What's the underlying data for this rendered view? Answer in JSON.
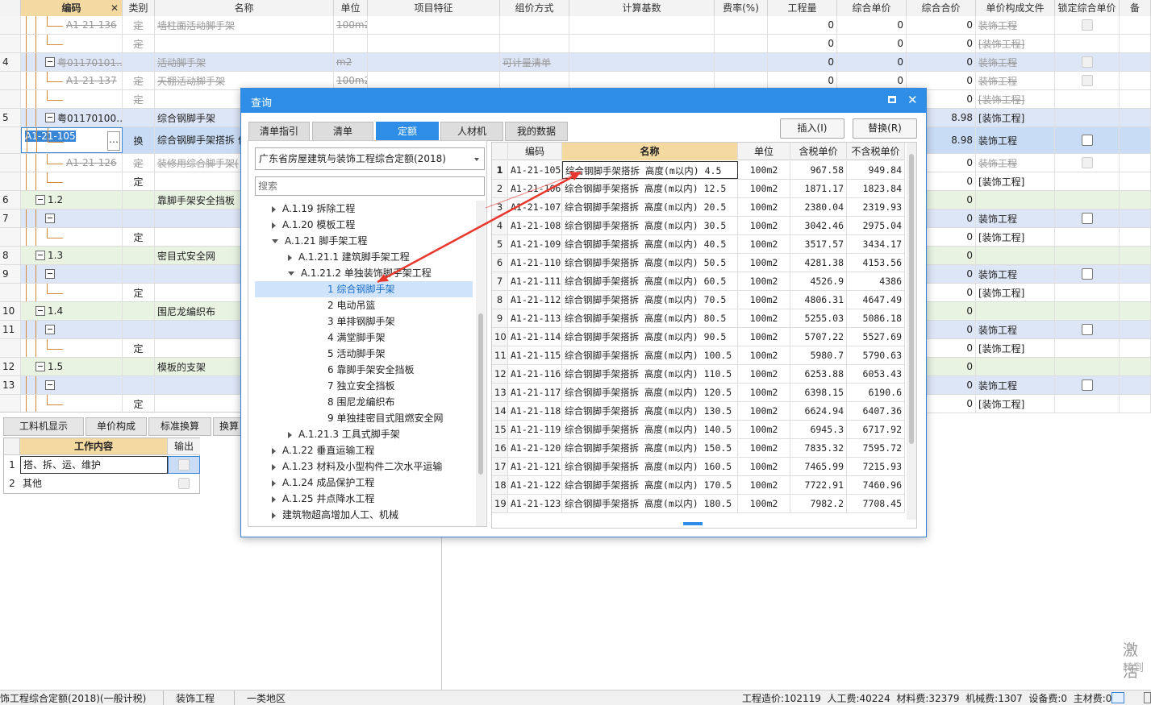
{
  "header": {
    "cols": [
      "编码",
      "类别",
      "名称",
      "单位",
      "项目特征",
      "组价方式",
      "计算基数",
      "费率(%)",
      "工程量",
      "综合单价",
      "综合合价",
      "单价构成文件",
      "锁定综合单价"
    ]
  },
  "rows": [
    {
      "no": "",
      "code": "A1-21-136",
      "type": "定",
      "name": "墙柱面活动脚手架",
      "unit": "100m2",
      "feat": "",
      "method": "",
      "base": "",
      "rate": "",
      "qty": "0",
      "price": "0",
      "total": "0",
      "file": "装饰工程",
      "strike": true,
      "bg": "#ffffff",
      "lvl": 2
    },
    {
      "no": "",
      "code": "",
      "type": "定",
      "name": "",
      "unit": "",
      "feat": "",
      "method": "",
      "base": "",
      "rate": "",
      "qty": "0",
      "price": "0",
      "total": "0",
      "file": "[装饰工程]",
      "strike": true,
      "bg": "#ffffff",
      "lvl": 2
    },
    {
      "no": "4",
      "code": "粤01170101…",
      "type": "",
      "name": "活动脚手架",
      "unit": "m2",
      "feat": "",
      "method": "可计量清单",
      "base": "",
      "rate": "",
      "qty": "0",
      "price": "0",
      "total": "0",
      "file": "装饰工程",
      "strike": true,
      "bg": "#dde6f7",
      "lvl": 1,
      "minus": true
    },
    {
      "no": "",
      "code": "A1-21-137",
      "type": "定",
      "name": "天棚活动脚手架",
      "unit": "100m2",
      "feat": "",
      "method": "",
      "base": "",
      "rate": "",
      "qty": "0",
      "price": "0",
      "total": "0",
      "file": "装饰工程",
      "strike": true,
      "bg": "#ffffff",
      "lvl": 2
    },
    {
      "no": "",
      "code": "",
      "type": "定",
      "name": "",
      "unit": "",
      "feat": "",
      "method": "",
      "base": "",
      "rate": "",
      "qty": "0",
      "price": "0",
      "total": "0",
      "file": "[装饰工程]",
      "strike": true,
      "bg": "#ffffff",
      "lvl": 2
    },
    {
      "no": "5",
      "code": "粤01170100…",
      "type": "",
      "name": "综合钢脚手架",
      "unit": "",
      "feat": "",
      "method": "",
      "base": "",
      "rate": "",
      "qty": "",
      "price": "",
      "total": "8.98",
      "file": "[装饰工程]",
      "strike": false,
      "bg": "#dde6f7",
      "lvl": 1,
      "minus": true
    },
    {
      "no": "",
      "code": "A1-21-105",
      "type": "换",
      "name": "综合钢脚手架搭拆 价*0.8",
      "unit": "",
      "feat": "",
      "method": "",
      "base": "",
      "rate": "",
      "qty": "",
      "price": "",
      "total": "8.98",
      "file": "装饰工程",
      "strike": false,
      "bg": "#c9dcf5",
      "lvl": 2
    },
    {
      "no": "",
      "code": "A1-21-126",
      "type": "定",
      "name": "装修用综合脚手架(",
      "unit": "",
      "feat": "",
      "method": "",
      "base": "",
      "rate": "",
      "qty": "",
      "price": "",
      "total": "0",
      "file": "装饰工程",
      "strike": true,
      "bg": "#ffffff",
      "lvl": 2
    },
    {
      "no": "",
      "code": "",
      "type": "定",
      "name": "",
      "unit": "",
      "feat": "",
      "method": "",
      "base": "",
      "rate": "",
      "qty": "",
      "price": "",
      "total": "0",
      "file": "[装饰工程]",
      "strike": false,
      "bg": "#ffffff",
      "lvl": 2
    },
    {
      "no": "6",
      "code": "1.2",
      "type": "",
      "name": "靠脚手架安全挡板",
      "unit": "",
      "feat": "",
      "method": "",
      "base": "",
      "rate": "",
      "qty": "",
      "price": "",
      "total": "0",
      "file": "",
      "strike": false,
      "bg": "#e8f3e2",
      "lvl": 0,
      "minus": true
    },
    {
      "no": "7",
      "code": "",
      "type": "",
      "name": "",
      "unit": "",
      "feat": "",
      "method": "",
      "base": "",
      "rate": "",
      "qty": "",
      "price": "",
      "total": "0",
      "file": "装饰工程",
      "strike": false,
      "bg": "#dde6f7",
      "lvl": 1,
      "minus": true
    },
    {
      "no": "",
      "code": "",
      "type": "定",
      "name": "",
      "unit": "",
      "feat": "",
      "method": "",
      "base": "",
      "rate": "",
      "qty": "",
      "price": "",
      "total": "0",
      "file": "[装饰工程]",
      "strike": false,
      "bg": "#ffffff",
      "lvl": 2
    },
    {
      "no": "8",
      "code": "1.3",
      "type": "",
      "name": "密目式安全网",
      "unit": "",
      "feat": "",
      "method": "",
      "base": "",
      "rate": "",
      "qty": "",
      "price": "",
      "total": "0",
      "file": "",
      "strike": false,
      "bg": "#e8f3e2",
      "lvl": 0,
      "minus": true
    },
    {
      "no": "9",
      "code": "",
      "type": "",
      "name": "",
      "unit": "",
      "feat": "",
      "method": "",
      "base": "",
      "rate": "",
      "qty": "",
      "price": "",
      "total": "0",
      "file": "装饰工程",
      "strike": false,
      "bg": "#dde6f7",
      "lvl": 1,
      "minus": true
    },
    {
      "no": "",
      "code": "",
      "type": "定",
      "name": "",
      "unit": "",
      "feat": "",
      "method": "",
      "base": "",
      "rate": "",
      "qty": "",
      "price": "",
      "total": "0",
      "file": "[装饰工程]",
      "strike": false,
      "bg": "#ffffff",
      "lvl": 2
    },
    {
      "no": "10",
      "code": "1.4",
      "type": "",
      "name": "围尼龙编织布",
      "unit": "",
      "feat": "",
      "method": "",
      "base": "",
      "rate": "",
      "qty": "",
      "price": "",
      "total": "0",
      "file": "",
      "strike": false,
      "bg": "#e8f3e2",
      "lvl": 0,
      "minus": true
    },
    {
      "no": "11",
      "code": "",
      "type": "",
      "name": "",
      "unit": "",
      "feat": "",
      "method": "",
      "base": "",
      "rate": "",
      "qty": "",
      "price": "",
      "total": "0",
      "file": "装饰工程",
      "strike": false,
      "bg": "#dde6f7",
      "lvl": 1,
      "minus": true
    },
    {
      "no": "",
      "code": "",
      "type": "定",
      "name": "",
      "unit": "",
      "feat": "",
      "method": "",
      "base": "",
      "rate": "",
      "qty": "",
      "price": "",
      "total": "0",
      "file": "[装饰工程]",
      "strike": false,
      "bg": "#ffffff",
      "lvl": 2
    },
    {
      "no": "12",
      "code": "1.5",
      "type": "",
      "name": "模板的支架",
      "unit": "",
      "feat": "",
      "method": "",
      "base": "",
      "rate": "",
      "qty": "",
      "price": "",
      "total": "0",
      "file": "",
      "strike": false,
      "bg": "#e8f3e2",
      "lvl": 0,
      "minus": true
    },
    {
      "no": "13",
      "code": "",
      "type": "",
      "name": "",
      "unit": "",
      "feat": "",
      "method": "",
      "base": "",
      "rate": "",
      "qty": "",
      "price": "",
      "total": "0",
      "file": "装饰工程",
      "strike": false,
      "bg": "#dde6f7",
      "lvl": 1,
      "minus": true
    },
    {
      "no": "",
      "code": "",
      "type": "定",
      "name": "",
      "unit": "",
      "feat": "",
      "method": "",
      "base": "",
      "rate": "",
      "qty": "",
      "price": "",
      "total": "0",
      "file": "[装饰工程]",
      "strike": false,
      "bg": "#ffffff",
      "lvl": 2
    }
  ],
  "bottom_tabs": [
    "工料机显示",
    "单价构成",
    "标准换算",
    "换算"
  ],
  "work": {
    "header_content": "工作内容",
    "header_output": "输出",
    "items": [
      {
        "no": "1",
        "text": "搭、拆、运、维护"
      },
      {
        "no": "2",
        "text": "其他"
      }
    ]
  },
  "dialog": {
    "title": "查询",
    "tabs": [
      "清单指引",
      "清单",
      "定额",
      "人材机",
      "我的数据"
    ],
    "insert": "插入(I)",
    "replace": "替换(R)",
    "dropdown": "广东省房屋建筑与装饰工程综合定额(2018)",
    "search_placeholder": "搜索",
    "tree": [
      {
        "t": "A.1.19 拆除工程",
        "ind": 0,
        "exp": "r"
      },
      {
        "t": "A.1.20 模板工程",
        "ind": 0,
        "exp": "r"
      },
      {
        "t": "A.1.21 脚手架工程",
        "ind": 0,
        "exp": "d"
      },
      {
        "t": "A.1.21.1 建筑脚手架工程",
        "ind": 1,
        "exp": "r"
      },
      {
        "t": "A.1.21.2 单独装饰脚手架工程",
        "ind": 1,
        "exp": "d"
      },
      {
        "t": "1 综合钢脚手架",
        "ind": 2,
        "exp": "",
        "sel": true
      },
      {
        "t": "2 电动吊篮",
        "ind": 2,
        "exp": ""
      },
      {
        "t": "3 单排钢脚手架",
        "ind": 2,
        "exp": ""
      },
      {
        "t": "4 满堂脚手架",
        "ind": 2,
        "exp": ""
      },
      {
        "t": "5 活动脚手架",
        "ind": 2,
        "exp": ""
      },
      {
        "t": "6 靠脚手架安全挡板",
        "ind": 2,
        "exp": ""
      },
      {
        "t": "7 独立安全挡板",
        "ind": 2,
        "exp": ""
      },
      {
        "t": "8 围尼龙编织布",
        "ind": 2,
        "exp": ""
      },
      {
        "t": "9 单独挂密目式阻燃安全网",
        "ind": 2,
        "exp": ""
      },
      {
        "t": "A.1.21.3 工具式脚手架",
        "ind": 1,
        "exp": "r"
      },
      {
        "t": "A.1.22 垂直运输工程",
        "ind": 0,
        "exp": "r"
      },
      {
        "t": "A.1.23 材料及小型构件二次水平运输",
        "ind": 0,
        "exp": "r"
      },
      {
        "t": "A.1.24 成品保护工程",
        "ind": 0,
        "exp": "r"
      },
      {
        "t": "A.1.25 井点降水工程",
        "ind": 0,
        "exp": "r"
      },
      {
        "t": "建筑物超高增加人工、机械",
        "ind": 0,
        "exp": "r"
      }
    ],
    "table_header": [
      "编码",
      "名称",
      "单位",
      "含税单价",
      "不含税单价"
    ],
    "table": [
      [
        "1",
        "A1-21-105",
        "综合钢脚手架搭拆 高度(m以内) 4.5",
        "100m2",
        "967.58",
        "949.84"
      ],
      [
        "2",
        "A1-21-106",
        "综合钢脚手架搭拆 高度(m以内) 12.5",
        "100m2",
        "1871.17",
        "1823.84"
      ],
      [
        "3",
        "A1-21-107",
        "综合钢脚手架搭拆 高度(m以内) 20.5",
        "100m2",
        "2380.04",
        "2319.93"
      ],
      [
        "4",
        "A1-21-108",
        "综合钢脚手架搭拆 高度(m以内) 30.5",
        "100m2",
        "3042.46",
        "2975.04"
      ],
      [
        "5",
        "A1-21-109",
        "综合钢脚手架搭拆 高度(m以内) 40.5",
        "100m2",
        "3517.57",
        "3434.17"
      ],
      [
        "6",
        "A1-21-110",
        "综合钢脚手架搭拆 高度(m以内) 50.5",
        "100m2",
        "4281.38",
        "4153.56"
      ],
      [
        "7",
        "A1-21-111",
        "综合钢脚手架搭拆 高度(m以内) 60.5",
        "100m2",
        "4526.9",
        "4386"
      ],
      [
        "8",
        "A1-21-112",
        "综合钢脚手架搭拆 高度(m以内) 70.5",
        "100m2",
        "4806.31",
        "4647.49"
      ],
      [
        "9",
        "A1-21-113",
        "综合钢脚手架搭拆 高度(m以内) 80.5",
        "100m2",
        "5255.03",
        "5086.18"
      ],
      [
        "10",
        "A1-21-114",
        "综合钢脚手架搭拆 高度(m以内) 90.5",
        "100m2",
        "5707.22",
        "5527.69"
      ],
      [
        "11",
        "A1-21-115",
        "综合钢脚手架搭拆 高度(m以内) 100.5",
        "100m2",
        "5980.7",
        "5790.63"
      ],
      [
        "12",
        "A1-21-116",
        "综合钢脚手架搭拆 高度(m以内) 110.5",
        "100m2",
        "6253.88",
        "6053.43"
      ],
      [
        "13",
        "A1-21-117",
        "综合钢脚手架搭拆 高度(m以内) 120.5",
        "100m2",
        "6398.15",
        "6190.6"
      ],
      [
        "14",
        "A1-21-118",
        "综合钢脚手架搭拆 高度(m以内) 130.5",
        "100m2",
        "6624.94",
        "6407.36"
      ],
      [
        "15",
        "A1-21-119",
        "综合钢脚手架搭拆 高度(m以内) 140.5",
        "100m2",
        "6945.3",
        "6717.92"
      ],
      [
        "16",
        "A1-21-120",
        "综合钢脚手架搭拆 高度(m以内) 150.5",
        "100m2",
        "7835.32",
        "7595.72"
      ],
      [
        "17",
        "A1-21-121",
        "综合钢脚手架搭拆 高度(m以内) 160.5",
        "100m2",
        "7465.99",
        "7215.93"
      ],
      [
        "18",
        "A1-21-122",
        "综合钢脚手架搭拆 高度(m以内) 170.5",
        "100m2",
        "7722.91",
        "7460.96"
      ],
      [
        "19",
        "A1-21-123",
        "综合钢脚手架搭拆 高度(m以内) 180.5",
        "100m2",
        "7982.2",
        "7708.45"
      ]
    ]
  },
  "watermark": {
    "line1": "激活",
    "line2": "转到"
  },
  "status": {
    "left": "饰工程综合定额(2018)(一般计税)",
    "mid1": "装饰工程",
    "mid2": "一类地区",
    "right": "工程造价:102119  人工费:40224  材料费:32379  机械费:1307  设备费:0  主材费:0"
  }
}
